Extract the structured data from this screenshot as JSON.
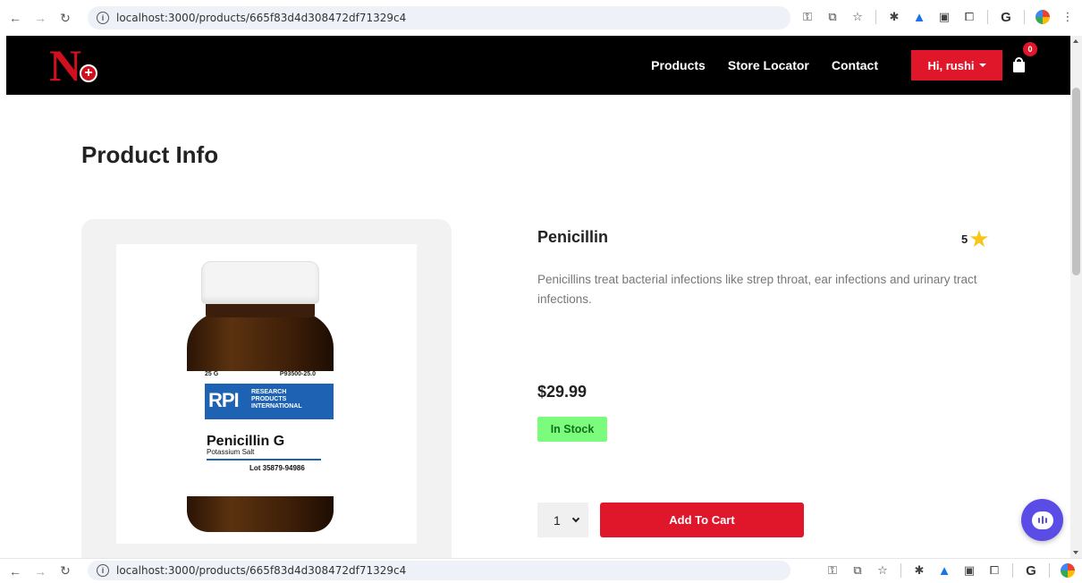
{
  "browser": {
    "url": "localhost:3000/products/665f83d4d308472df71329c4",
    "back_icon": "arrow-left-icon",
    "forward_icon": "arrow-right-icon",
    "reload_icon": "reload-icon"
  },
  "navbar": {
    "logo_letter": "N",
    "logo_plus": "+",
    "links": [
      "Products",
      "Store Locator",
      "Contact"
    ],
    "user_label": "Hi, rushi",
    "cart_count": "0"
  },
  "page": {
    "title": "Product Info"
  },
  "product": {
    "name": "Penicillin",
    "rating": "5",
    "description": "Penicillins treat bacterial infections like strep throat, ear infections and urinary tract infections.",
    "price": "$29.99",
    "stock_status": "In Stock",
    "quantity": "1",
    "add_to_cart_label": "Add To Cart",
    "image_label": {
      "weight": "25 G",
      "code": "P93500-25.0",
      "brand": "RPI",
      "brand_sub": "RESEARCH PRODUCTS INTERNATIONAL",
      "name": "Penicillin G",
      "salt": "Potassium Salt",
      "lot": "Lot 35879-94986"
    }
  },
  "colors": {
    "accent": "#e0172a",
    "navbar_bg": "#000000",
    "stock_bg": "#7cfc7c",
    "chat_bg": "#5b4ce6",
    "star": "#f8c518"
  }
}
